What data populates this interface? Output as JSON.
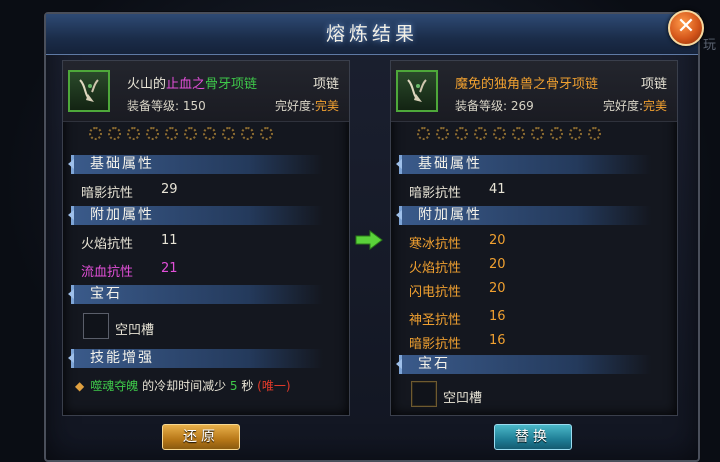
{
  "window": {
    "title": "熔炼结果"
  },
  "background": {
    "hint_text": "玩"
  },
  "close_button": {
    "label": "✕"
  },
  "left": {
    "name_parts": [
      "火山的",
      "止血之",
      "骨牙项链"
    ],
    "type": "项链",
    "level_label": "装备等级: 150",
    "condition_label": "完好度:",
    "condition_value": "完美",
    "socket_count": 10,
    "sections": {
      "base": "基础属性",
      "extra": "附加属性",
      "gem": "宝石",
      "skill": "技能增强"
    },
    "base_attrs": [
      {
        "name": "暗影抗性",
        "value": "29"
      }
    ],
    "extra_attrs": [
      {
        "name": "火焰抗性",
        "value": "11"
      },
      {
        "name": "流血抗性",
        "value": "21"
      }
    ],
    "gem_label": "空凹槽",
    "skill": {
      "bullet": "◆",
      "skill_name": "噬魂夺魄",
      "text_a": " 的冷却时间减少 ",
      "amount": "5",
      "text_b": " 秒 ",
      "tag": "(唯一)"
    }
  },
  "right": {
    "name": "魔免的独角兽之骨牙项链",
    "type": "项链",
    "level_label": "装备等级: 269",
    "condition_label": "完好度:",
    "condition_value": "完美",
    "socket_count": 10,
    "sections": {
      "base": "基础属性",
      "extra": "附加属性",
      "gem": "宝石"
    },
    "base_attrs": [
      {
        "name": "暗影抗性",
        "value": "41"
      }
    ],
    "extra_attrs": [
      {
        "name": "寒冰抗性",
        "value": "20"
      },
      {
        "name": "火焰抗性",
        "value": "20"
      },
      {
        "name": "闪电抗性",
        "value": "20"
      },
      {
        "name": "神圣抗性",
        "value": "16"
      },
      {
        "name": "暗影抗性",
        "value": "16"
      }
    ],
    "gem_label": "空凹槽"
  },
  "buttons": {
    "restore": "还原",
    "replace": "替换"
  },
  "colors": {
    "orange": "#f0a030",
    "pink": "#e24fd8",
    "green": "#3ec84a",
    "red": "#e03a2a",
    "title_bar": "#2e4a74"
  },
  "icons": {
    "arrow": "arrow-right-icon",
    "close": "close-icon",
    "item": "bone-necklace-icon"
  }
}
